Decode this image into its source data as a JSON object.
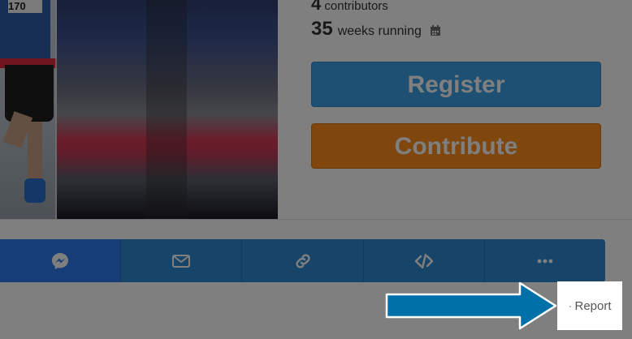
{
  "stats": {
    "contributors_count": "4",
    "contributors_label": "contributors",
    "weeks_count": "35",
    "weeks_label": "weeks running",
    "calendar_icon": "calendar-icon"
  },
  "photo": {
    "bib_text": "170"
  },
  "buttons": {
    "register_label": "Register",
    "contribute_label": "Contribute"
  },
  "share": {
    "items": [
      {
        "icon": "messenger-icon"
      },
      {
        "icon": "email-icon"
      },
      {
        "icon": "link-icon"
      },
      {
        "icon": "embed-code-icon"
      },
      {
        "icon": "more-icon"
      }
    ]
  },
  "report": {
    "dot": "·",
    "label": "Report"
  },
  "colors": {
    "register": "#3aa0e4",
    "contribute": "#ff8c1a",
    "share_bar": "#2d8ad2",
    "messenger": "#2e7bf0",
    "arrow": "#0071a8"
  }
}
